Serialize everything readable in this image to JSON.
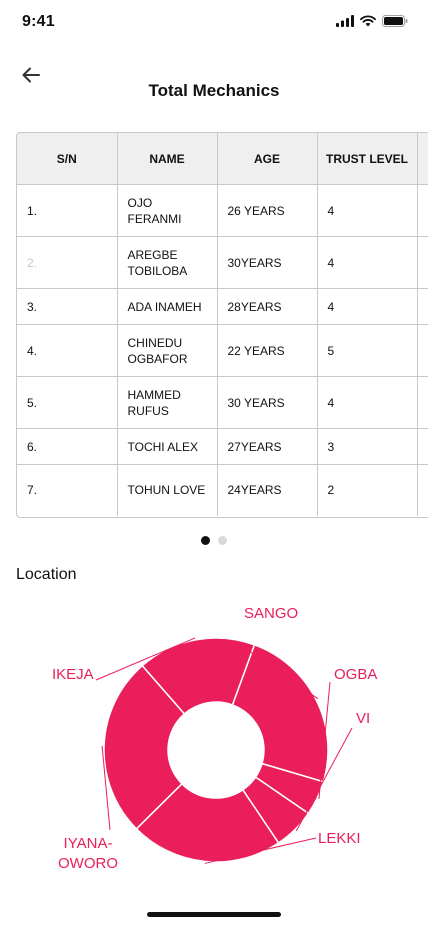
{
  "status_bar": {
    "time": "9:41"
  },
  "header": {
    "title": "Total Mechanics"
  },
  "table": {
    "columns": [
      "S/N",
      "NAME",
      "AGE",
      "TRUST LEVEL",
      ""
    ],
    "rows": [
      {
        "sn": "1.",
        "name": "OJO FERANMI",
        "age": "26  YEARS",
        "trust": "4"
      },
      {
        "sn": "2.",
        "name": "AREGBE TOBILOBA",
        "age": "30YEARS",
        "trust": "4"
      },
      {
        "sn": "3.",
        "name": "ADA INAMEH",
        "age": "28YEARS",
        "trust": "4"
      },
      {
        "sn": "4.",
        "name": "CHINEDU OGBAFOR",
        "age": "22 YEARS",
        "trust": "5"
      },
      {
        "sn": "5.",
        "name": "HAMMED RUFUS",
        "age": "30 YEARS",
        "trust": "4"
      },
      {
        "sn": "6.",
        "name": "TOCHI ALEX",
        "age": "27YEARS",
        "trust": "3"
      },
      {
        "sn": "7.",
        "name": "TOHUN LOVE",
        "age": "24YEARS",
        "trust": "2"
      }
    ]
  },
  "pagination": {
    "total": 2,
    "active": 1
  },
  "location": {
    "label": "Location"
  },
  "colors": {
    "accent": "#e91e5a",
    "table_header_bg": "#efefef",
    "border": "#c9c9c9"
  },
  "chart_data": {
    "type": "pie",
    "title": "",
    "categories": [
      "SANGO",
      "OGBA",
      "VI",
      "LEKKI",
      "IYANA-OWORO",
      "IKEJA"
    ],
    "values": [
      24,
      5,
      6,
      22,
      26,
      17
    ]
  }
}
